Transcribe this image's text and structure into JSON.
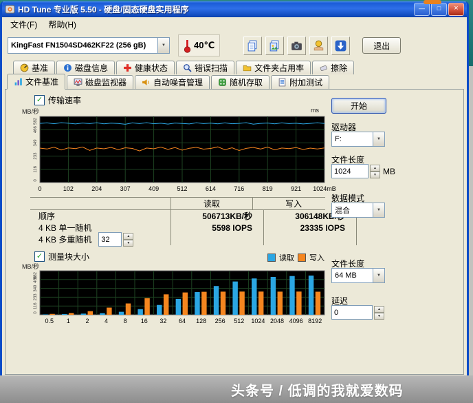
{
  "window": {
    "title": "HD Tune 专业版 5.50 - 硬盘/固态硬盘实用程序",
    "controls": {
      "minimize": "—",
      "maximize": "□",
      "close": "×"
    }
  },
  "menu": {
    "file": "文件(F)",
    "help": "帮助(H)"
  },
  "toolbar": {
    "drive_select": "KingFast FN1504SD462KF22  (256 gB)",
    "temperature": "40℃",
    "exit_label": "退出"
  },
  "tabs": {
    "row1": [
      {
        "label": "基准"
      },
      {
        "label": "磁盘信息"
      },
      {
        "label": "健康状态"
      },
      {
        "label": "错误扫描"
      },
      {
        "label": "文件夹占用率"
      },
      {
        "label": "擦除"
      }
    ],
    "row2": [
      {
        "label": "文件基准",
        "active": true
      },
      {
        "label": "磁盘监视器"
      },
      {
        "label": "自动噪音管理"
      },
      {
        "label": "随机存取"
      },
      {
        "label": "附加测试"
      }
    ]
  },
  "file_benchmark": {
    "transfer_checkbox": "传输速率",
    "blocksize_checkbox": "测量块大小",
    "y_unit": "MB/秒",
    "right_unit": "ms",
    "legend_read": "读取",
    "legend_write": "写入"
  },
  "results_table": {
    "header_read": "读取",
    "header_write": "写入",
    "rows": [
      {
        "label": "顺序",
        "read": "506713KB/秒",
        "write": "306148KB/秒"
      },
      {
        "label": "4 KB 单一随机",
        "read": "5598 IOPS",
        "write": "23335 IOPS"
      },
      {
        "label": "4 KB 多重随机",
        "read": "",
        "write": ""
      }
    ],
    "multi_random_queue": "32"
  },
  "side_panel": {
    "start_button": "开始",
    "drive_label": "驱动器",
    "drive_value": "F:",
    "file_length_label": "文件长度",
    "file_length_value": "1024",
    "file_length_unit": "MB",
    "data_mode_label": "数据模式",
    "data_mode_value": "混合",
    "block_file_length_label": "文件长度",
    "block_file_length_value": "64 MB",
    "delay_label": "延迟",
    "delay_value": "0"
  },
  "watermark": "头条号 / 低调的我就爱数码",
  "colors": {
    "read": "#2ba6e3",
    "write": "#f5861f"
  },
  "chart_data": [
    {
      "type": "line",
      "title": "传输速率",
      "xlabel": "",
      "ylabel": "MB/秒",
      "right_axis_label": "ms",
      "xlim": [
        0,
        1024
      ],
      "ylim": [
        0,
        582
      ],
      "y_ticks": [
        0,
        116,
        233,
        349,
        466,
        582
      ],
      "x_ticks": [
        "0",
        "102",
        "204",
        "307",
        "409",
        "512",
        "614",
        "716",
        "819",
        "921",
        "1024mB"
      ],
      "bg": "#000000",
      "grid": "#1e4322",
      "x": [
        0,
        26,
        51,
        77,
        102,
        128,
        154,
        179,
        205,
        230,
        256,
        282,
        307,
        333,
        358,
        384,
        410,
        435,
        461,
        486,
        512,
        538,
        563,
        589,
        614,
        640,
        666,
        691,
        717,
        742,
        768,
        794,
        819,
        845,
        870,
        896,
        922,
        947,
        973,
        998,
        1024
      ],
      "series": [
        {
          "name": "读取",
          "color": "#2ba6e3",
          "values": [
            521,
            525,
            518,
            527,
            522,
            516,
            524,
            519,
            526,
            517,
            523,
            520,
            513,
            525,
            519,
            527,
            518,
            522,
            515,
            524,
            520,
            516,
            526,
            519,
            523,
            517,
            525,
            518,
            521,
            527,
            514,
            521,
            524,
            517,
            525,
            519,
            522,
            516,
            521,
            526,
            520
          ]
        },
        {
          "name": "写入",
          "color": "#f5861f",
          "values": [
            303,
            295,
            311,
            287,
            305,
            299,
            313,
            283,
            304,
            297,
            309,
            290,
            306,
            300,
            278,
            304,
            297,
            312,
            292,
            308,
            285,
            302,
            310,
            294,
            300,
            314,
            289,
            306,
            282,
            301,
            309,
            295,
            312,
            288,
            304,
            298,
            308,
            291,
            303,
            296,
            305
          ]
        }
      ]
    },
    {
      "type": "bar",
      "title": "测量块大小",
      "xlabel": "",
      "ylabel": "MB/秒",
      "ylim": [
        0,
        582
      ],
      "y_ticks": [
        0,
        116,
        233,
        349,
        466,
        582
      ],
      "bg": "#000000",
      "grid": "#1e4322",
      "legend_position": "top-right",
      "categories": [
        "0.5",
        "1",
        "2",
        "4",
        "8",
        "16",
        "32",
        "64",
        "128",
        "256",
        "512",
        "1024",
        "2048",
        "4096",
        "8192"
      ],
      "series": [
        {
          "name": "读取",
          "color": "#2ba6e3",
          "values": [
            5,
            10,
            16,
            22,
            40,
            75,
            130,
            210,
            300,
            380,
            440,
            480,
            500,
            512,
            518
          ]
        },
        {
          "name": "写入",
          "color": "#f5861f",
          "values": [
            12,
            24,
            48,
            95,
            150,
            220,
            270,
            295,
            304,
            306,
            307,
            307,
            306,
            307,
            305
          ]
        }
      ]
    }
  ]
}
